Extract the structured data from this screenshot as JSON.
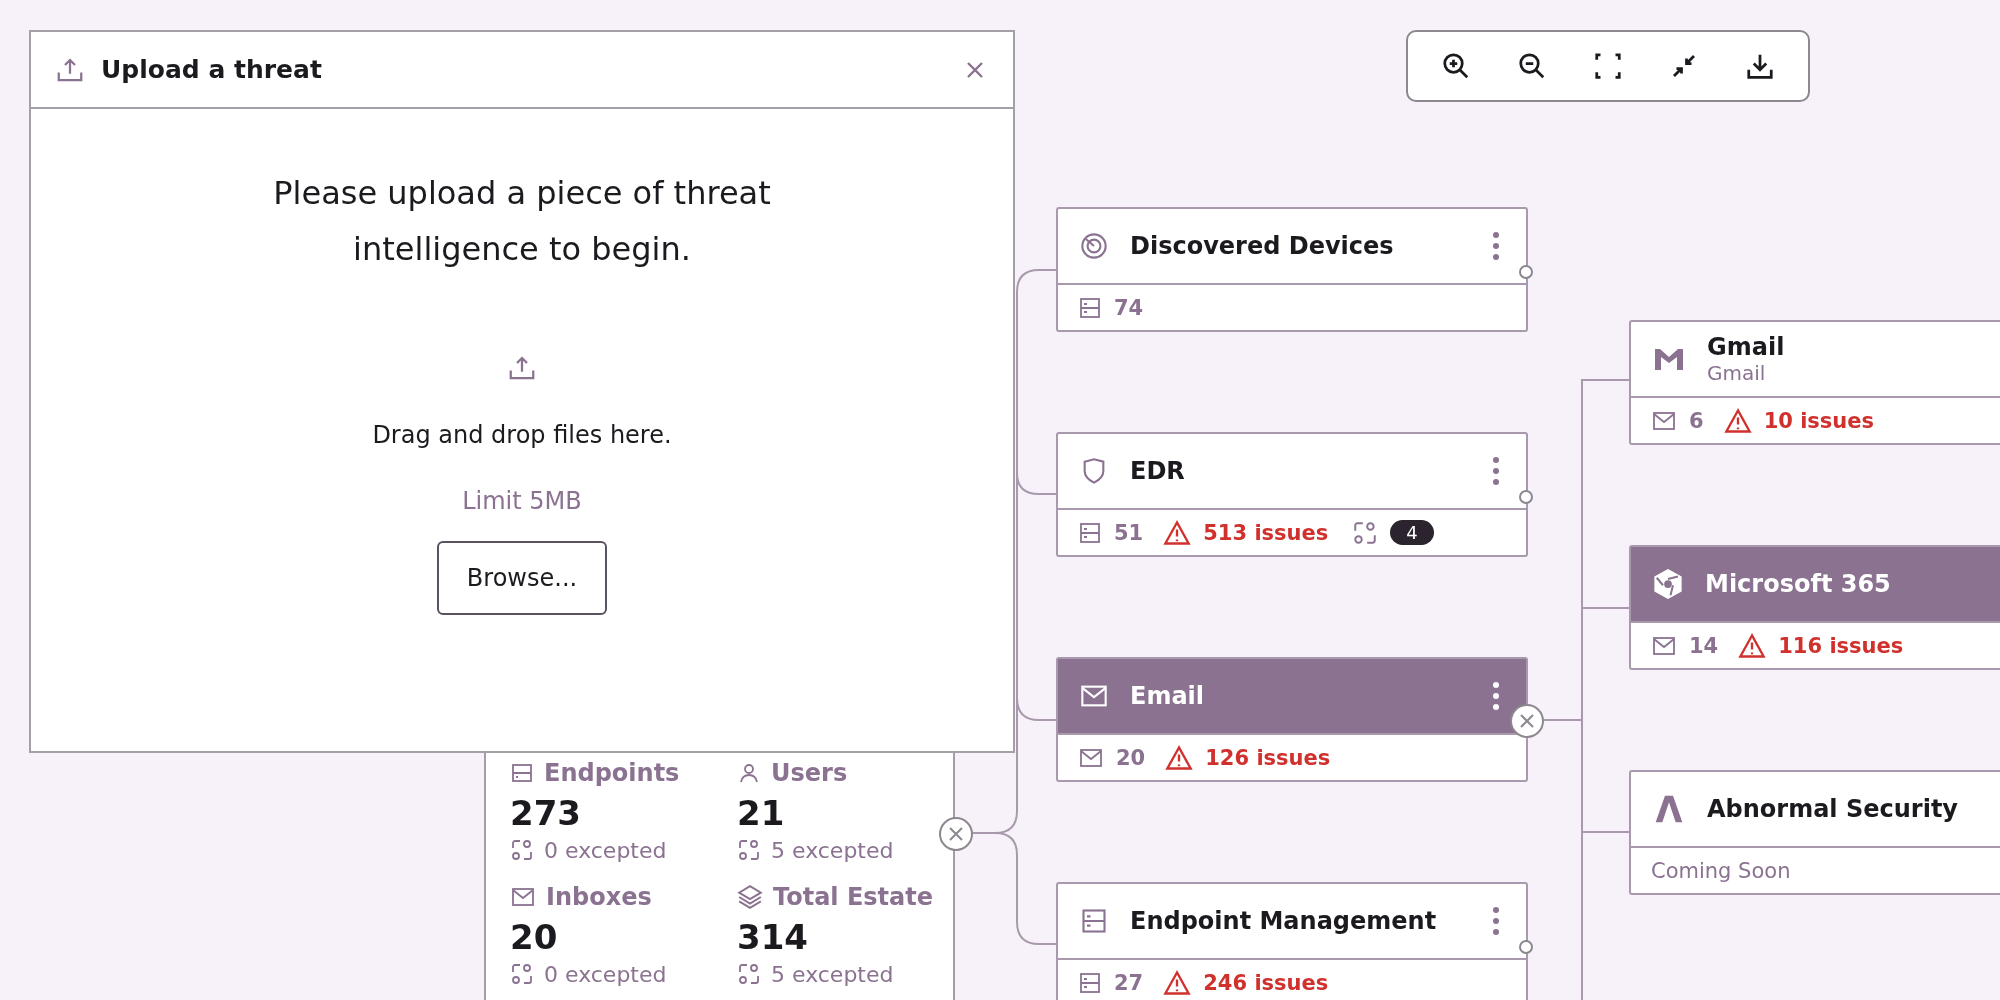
{
  "upload_dialog": {
    "title": "Upload a threat",
    "message": "Please upload a piece of threat intelligence to begin.",
    "drop_hint": "Drag and drop files here.",
    "limit": "Limit 5MB",
    "button": "Browse..."
  },
  "estate_summary": {
    "stats": [
      {
        "kind": "endpoints",
        "label": "Endpoints",
        "value": "273",
        "excepted": "0 excepted"
      },
      {
        "kind": "users",
        "label": "Users",
        "value": "21",
        "excepted": "5 excepted"
      },
      {
        "kind": "inboxes",
        "label": "Inboxes",
        "value": "20",
        "excepted": "0 excepted"
      },
      {
        "kind": "total",
        "label": "Total Estate",
        "value": "314",
        "excepted": "5 excepted"
      }
    ]
  },
  "sources": [
    {
      "kind": "devices",
      "title": "Discovered Devices",
      "selected": false,
      "count": "74"
    },
    {
      "kind": "edr",
      "title": "EDR",
      "selected": false,
      "count": "51",
      "issues": "513 issues",
      "exceptions": "4"
    },
    {
      "kind": "email",
      "title": "Email",
      "selected": true,
      "count": "20",
      "issues": "126 issues"
    },
    {
      "kind": "endpoint",
      "title": "Endpoint Management",
      "selected": false,
      "count": "27",
      "issues": "246 issues"
    }
  ],
  "integrations": [
    {
      "kind": "gmail",
      "title": "Gmail",
      "subtitle": "Gmail",
      "selected": false,
      "count": "6",
      "issues": "10 issues"
    },
    {
      "kind": "m365",
      "title": "Microsoft 365",
      "selected": true,
      "count": "14",
      "issues": "116 issues"
    },
    {
      "kind": "abnormal",
      "title": "Abnormal Security",
      "selected": false,
      "note": "Coming Soon"
    }
  ]
}
